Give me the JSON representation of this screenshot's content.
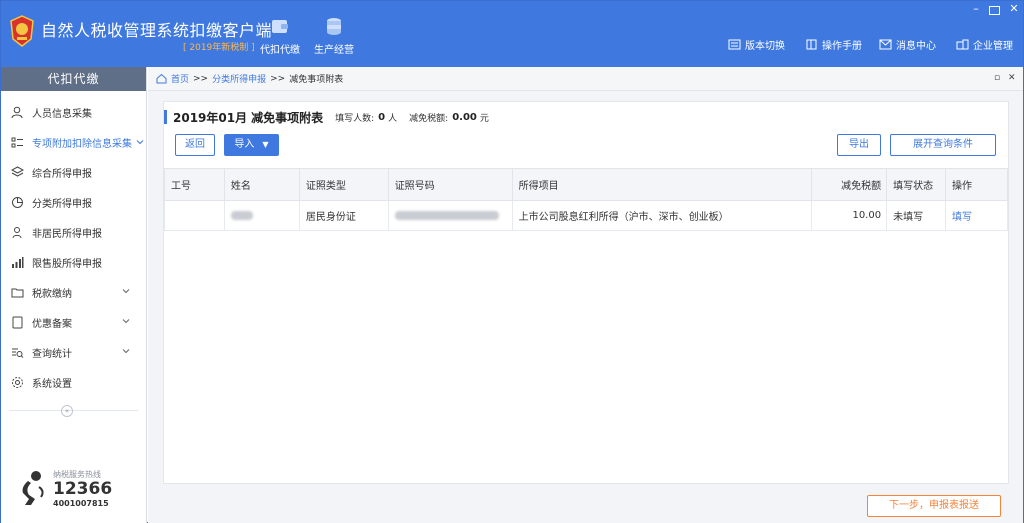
{
  "app": {
    "title": "自然人税收管理系统扣缴客户端",
    "subtitle": "[ 2019年新税制 ]",
    "accent": "#3f79df",
    "topnav": [
      {
        "label": "代扣代缴",
        "icon": "wallet-icon"
      },
      {
        "label": "生产经营",
        "icon": "coins-icon"
      }
    ],
    "toplinks": [
      {
        "label": "版本切换",
        "icon": "version-icon"
      },
      {
        "label": "操作手册",
        "icon": "manual-icon"
      },
      {
        "label": "消息中心",
        "icon": "mail-icon"
      },
      {
        "label": "企业管理",
        "icon": "company-icon"
      }
    ]
  },
  "sidebar": {
    "header": "代扣代缴",
    "items": [
      {
        "label": "人员信息采集",
        "icon": "person-icon",
        "expandable": false,
        "active": false
      },
      {
        "label": "专项附加扣除信息采集",
        "icon": "list-icon",
        "expandable": true,
        "active": true
      },
      {
        "label": "综合所得申报",
        "icon": "layers-icon",
        "expandable": false,
        "active": false
      },
      {
        "label": "分类所得申报",
        "icon": "pie-icon",
        "expandable": false,
        "active": false
      },
      {
        "label": "非居民所得申报",
        "icon": "person-outline-icon",
        "expandable": false,
        "active": false
      },
      {
        "label": "限售股所得申报",
        "icon": "bar-chart-icon",
        "expandable": false,
        "active": false
      },
      {
        "label": "税款缴纳",
        "icon": "folder-icon",
        "expandable": true,
        "active": false
      },
      {
        "label": "优惠备案",
        "icon": "document-icon",
        "expandable": true,
        "active": false
      },
      {
        "label": "查询统计",
        "icon": "query-icon",
        "expandable": true,
        "active": false
      },
      {
        "label": "系统设置",
        "icon": "gear-icon",
        "expandable": false,
        "active": false
      }
    ],
    "collapse_glyph": "«",
    "hotline": {
      "label": "纳税服务热线",
      "number": "12366",
      "number2": "4001007815"
    }
  },
  "breadcrumb": {
    "home": "首页",
    "sep": ">>",
    "level1": "分类所得申报",
    "current": "减免事项附表"
  },
  "panel": {
    "period": "2019年01月",
    "title": "减免事项附表",
    "count_label": "填写人数:",
    "count_value": "0",
    "count_unit": "人",
    "tax_label": "减免税额:",
    "tax_value": "0.00",
    "tax_unit": "元",
    "buttons": {
      "back": "返回",
      "import": "导入",
      "export": "导出",
      "expand_query": "展开查询条件"
    },
    "table": {
      "columns": [
        "工号",
        "姓名",
        "证照类型",
        "证照号码",
        "所得项目",
        "减免税额",
        "填写状态",
        "操作"
      ],
      "rows": [
        {
          "id": "",
          "id_type": "居民身份证",
          "income_item": "上市公司股息红利所得（沪市、深市、创业板）",
          "tax": "10.00",
          "status": "未填写",
          "action": "填写"
        }
      ]
    }
  },
  "footer": {
    "next_button": "下一步，申报表报送",
    "next_color": "#f5843b"
  }
}
